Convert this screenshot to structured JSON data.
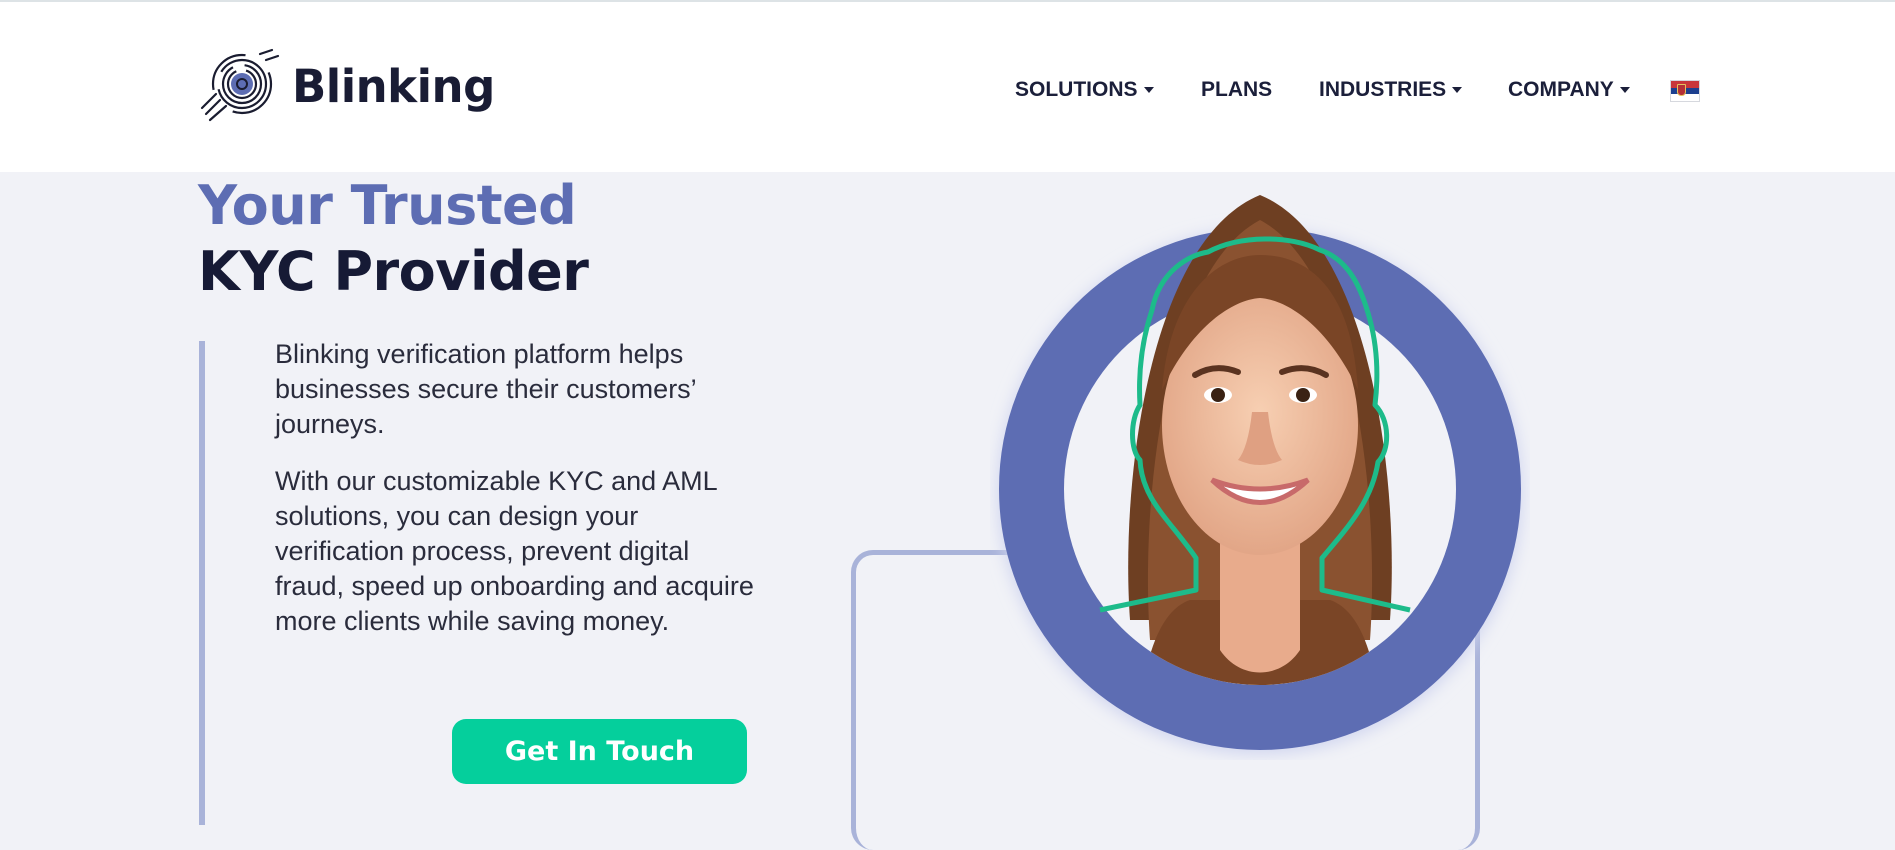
{
  "header": {
    "brand": "Blinking",
    "nav": [
      {
        "label": "SOLUTIONS",
        "dropdown": true
      },
      {
        "label": "PLANS",
        "dropdown": false
      },
      {
        "label": "INDUSTRIES",
        "dropdown": true
      },
      {
        "label": "COMPANY",
        "dropdown": true
      }
    ],
    "language_icon": "serbia-flag-icon"
  },
  "hero": {
    "title_line1": "Your Trusted",
    "title_line2": "KYC Provider",
    "paragraph1": "Blinking verification platform helps businesses secure their customers’ journeys.",
    "paragraph2": "With our customizable KYC and AML solutions, you can design your verification process, prevent digital fraud, speed up onboarding and acquire more clients while saving money.",
    "cta_label": "Get In Touch"
  },
  "colors": {
    "accent_blue": "#5d6db3",
    "cta_green": "#05cf9c",
    "face_outline_green": "#1dbb8a",
    "navy_text": "#161a35",
    "frame_line": "#a9b3d9",
    "page_background": "#f1f2f7"
  }
}
